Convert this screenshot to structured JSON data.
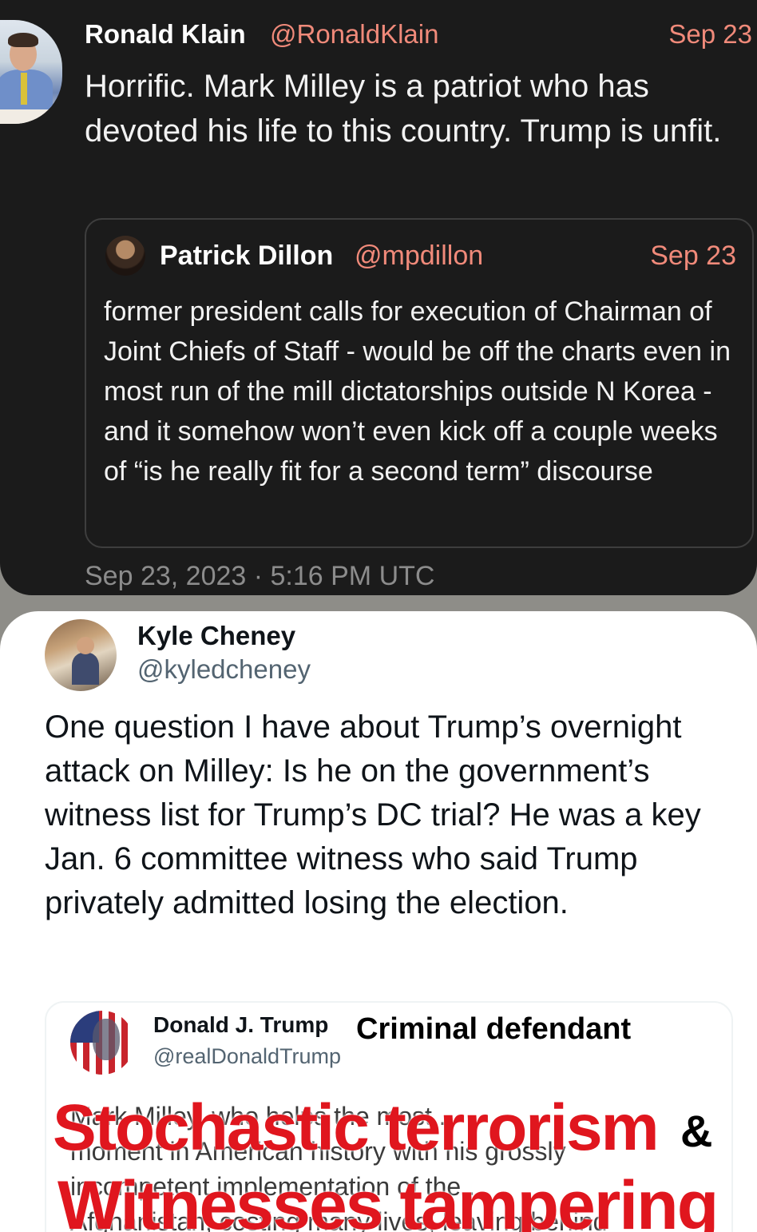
{
  "klain_tweet": {
    "name": "Ronald Klain",
    "handle": "@RonaldKlain",
    "date": "Sep 23",
    "text": "Horrific.  Mark Milley is a patriot who has devoted his life to this country.  Trump is unfit.",
    "timestamp": "Sep 23, 2023 · 5:16 PM UTC"
  },
  "dillon_quote": {
    "name": "Patrick Dillon",
    "handle": "@mpdillon",
    "date": "Sep 23",
    "text": "former president calls for execution of Chairman of Joint Chiefs of Staff - would be off the charts even in most run of the mill dictatorships outside N Korea - and it somehow won’t even kick off a couple weeks of “is he really fit for a second term” discourse"
  },
  "cheney_tweet": {
    "name": "Kyle Cheney",
    "handle": "@kyledcheney",
    "text": "One question I have about Trump’s overnight attack on Milley: Is he on the government’s witness list for Trump’s DC trial? He was a key Jan. 6 committee witness who said Trump privately admitted losing the election."
  },
  "trump_quote": {
    "name": "Donald J. Trump",
    "handle": "@realDonaldTrump",
    "overlay_label": "Criminal defendant",
    "body_lines": [
      "Mark Milley, who helps the most...",
      "moment in American history with his grossly",
      "incompetent implementation of the ...",
      "Afghanistan, costing many lives, leaving behind"
    ]
  },
  "overlay_text": {
    "line1": "Stochastic terrorism",
    "amp": "&",
    "line2": "Witnesses tampering"
  },
  "colors": {
    "dark_bg": "#1b1b1b",
    "accent_salmon": "#f08a7a",
    "overlay_red": "#e0161e"
  }
}
